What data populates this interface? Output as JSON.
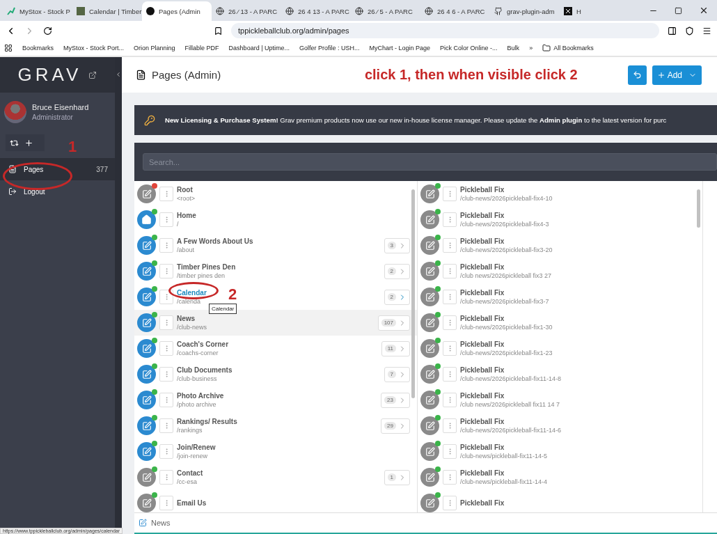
{
  "browser": {
    "tabs": [
      {
        "label": "MyStox - Stock P",
        "kind": "stock",
        "selected": false
      },
      {
        "label": "Calendar | Timber",
        "kind": "calendar",
        "selected": false
      },
      {
        "label": "Pages (Admin",
        "kind": "grav",
        "selected": true
      },
      {
        "label": "26 ⁄ 13 - A PARC",
        "kind": "globe",
        "selected": false
      },
      {
        "label": "26 4 13 - A PARC",
        "kind": "globe",
        "selected": false
      },
      {
        "label": "26 ⁄ 5 - A PARC",
        "kind": "globe",
        "selected": false
      },
      {
        "label": "26 4 6 - A PARC",
        "kind": "globe",
        "selected": false
      },
      {
        "label": "grav-plugin-adm",
        "kind": "github",
        "selected": false
      },
      {
        "label": "H",
        "kind": "x",
        "selected": false
      }
    ],
    "address": "tppickleballclub.org/admin/pages",
    "bookmarks": [
      "Bookmarks",
      "MyStox - Stock Port...",
      "Orion Planning",
      "Fillable PDF",
      "Dashboard | Uptime...",
      "Golfer Profile : USH...",
      "MyChart - Login Page",
      "Pick Color Online -...",
      "Bulk"
    ],
    "more": "»",
    "all_bookmarks": "All Bookmarks"
  },
  "sidebar": {
    "logo": "GRAV",
    "user": {
      "name": "Bruce Eisenhard",
      "role": "Administrator"
    },
    "nav": [
      {
        "label": "Pages",
        "kind": "pages",
        "count": "377",
        "selected": true
      },
      {
        "label": "Logout",
        "kind": "logout",
        "selected": false
      }
    ]
  },
  "header": {
    "title": "Pages (Admin)",
    "add_label": "Add"
  },
  "annotations": {
    "instruction": "click 1, then when visible click 2",
    "marks": [
      "1",
      "2"
    ]
  },
  "notice": "**New Licensing & Purchase System!** Grav premium products now use our new in-house license manager. Please update the **Admin plugin** to the latest version for purc",
  "search": {
    "placeholder": "Search..."
  },
  "pages": [
    {
      "title": "Root",
      "path": "<root>",
      "kind": "page",
      "visible": false,
      "color": "#e0443a",
      "selected": false,
      "hover": false
    },
    {
      "title": "Home",
      "path": "/",
      "kind": "home",
      "visible": true,
      "color": "#3bb44a",
      "selected": false,
      "hover": false
    },
    {
      "title": "A Few Words About Us",
      "path": "/about",
      "count": "3",
      "kind": "page",
      "visible": true,
      "color": "#3bb44a",
      "selected": false,
      "hover": false
    },
    {
      "title": "Timber Pines Den",
      "path": "/timber pines den",
      "count": "2",
      "kind": "page",
      "visible": true,
      "color": "#3bb44a",
      "selected": false,
      "hover": false
    },
    {
      "title": "Calendar",
      "path": "/calenda",
      "count": "2",
      "kind": "page",
      "visible": true,
      "color": "#3bb44a",
      "selected": true,
      "hover": false
    },
    {
      "title": "News",
      "path": "/club-news",
      "count": "107",
      "kind": "page",
      "visible": true,
      "color": "#3bb44a",
      "selected": false,
      "hover": true
    },
    {
      "title": "Coach's Corner",
      "path": "/coachs-corner",
      "count": "11",
      "kind": "page",
      "visible": true,
      "color": "#3bb44a",
      "selected": false,
      "hover": false
    },
    {
      "title": "Club Documents",
      "path": "/club-business",
      "count": "7",
      "kind": "page",
      "visible": true,
      "color": "#3bb44a",
      "selected": false,
      "hover": false
    },
    {
      "title": "Photo Archive",
      "path": "/photo archive",
      "count": "23",
      "kind": "page",
      "visible": true,
      "color": "#3bb44a",
      "selected": false,
      "hover": false
    },
    {
      "title": "Rankings/ Results",
      "path": "/rankings",
      "count": "29",
      "kind": "page",
      "visible": true,
      "color": "#3bb44a",
      "selected": false,
      "hover": false
    },
    {
      "title": "Join/Renew",
      "path": "/join-renew",
      "kind": "page",
      "visible": true,
      "color": "#3bb44a",
      "selected": false,
      "hover": false
    },
    {
      "title": "Contact",
      "path": "/cc-esa",
      "count": "1",
      "kind": "page",
      "visible": false,
      "color": "#3bb44a",
      "selected": false,
      "hover": false
    },
    {
      "title": "Email Us",
      "kind": "page",
      "visible": false,
      "color": "#3bb44a",
      "selected": false,
      "hover": false
    }
  ],
  "children": [
    {
      "title": "Pickleball Fix",
      "path": "/club-news/2026pickleball-fix4-10"
    },
    {
      "title": "Pickleball Fix",
      "path": "/club-news/2026pickleball-fix4-3"
    },
    {
      "title": "Pickleball Fix",
      "path": "/club-news/2026pickleball-fix3-20"
    },
    {
      "title": "Pickleball Fix",
      "path": "/club news/2026pickleball fix3 27"
    },
    {
      "title": "Pickleball Fix",
      "path": "/club-news/2026pickleball-fix3-7"
    },
    {
      "title": "Pickleball Fix",
      "path": "/club-news/2026pickleball-fix1-30"
    },
    {
      "title": "Pickleball Fix",
      "path": "/club-news/2026pickleball-fix1-23"
    },
    {
      "title": "Pickleball Fix",
      "path": "/club-news/2026pickleball-fix11-14-8"
    },
    {
      "title": "Pickleball Fix",
      "path": "/club news/2026pickleball fix11 14 7"
    },
    {
      "title": "Pickleball Fix",
      "path": "/club-news/2026pickleball-fix11-14-6"
    },
    {
      "title": "Pickleball Fix",
      "path": "/club-news/pickleball-fix11-14-5"
    },
    {
      "title": "Pickleball Fix",
      "path": "/club-news/pickleball-fix11-14-4"
    },
    {
      "title": "Pickleball Fix"
    }
  ],
  "tooltip": "Calendar",
  "breadcrumb": "News",
  "status_url": "https://www.tppickleballclub.org/admin/pages/calendar"
}
